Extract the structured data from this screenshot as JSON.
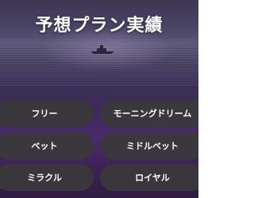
{
  "header": {
    "title": "予想プラン実績"
  },
  "plans": [
    {
      "label": "フリー"
    },
    {
      "label": "モーニングドリーム"
    },
    {
      "label": "ベット"
    },
    {
      "label": "ミドルベット"
    },
    {
      "label": "ミラクル"
    },
    {
      "label": "ロイヤル"
    }
  ],
  "colors": {
    "button_bg": "#3a3a3a",
    "text": "#ffffff"
  }
}
